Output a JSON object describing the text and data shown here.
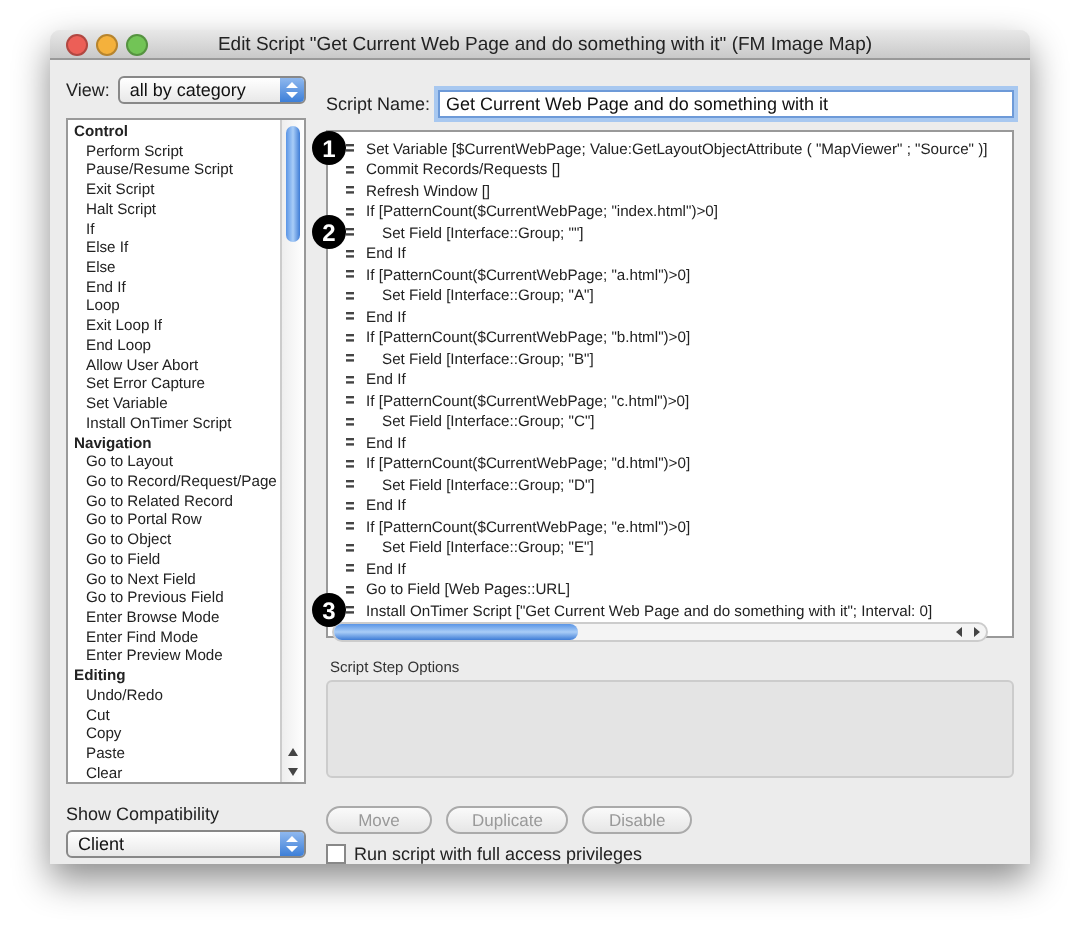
{
  "window": {
    "title": "Edit Script \"Get Current Web Page and do something with it\" (FM Image Map)"
  },
  "view": {
    "label": "View:",
    "value": "all by category"
  },
  "steps": [
    {
      "kind": "header",
      "label": "Control"
    },
    {
      "kind": "item",
      "label": "Perform Script"
    },
    {
      "kind": "item",
      "label": "Pause/Resume Script"
    },
    {
      "kind": "item",
      "label": "Exit Script"
    },
    {
      "kind": "item",
      "label": "Halt Script"
    },
    {
      "kind": "item",
      "label": "If"
    },
    {
      "kind": "item",
      "label": "Else If"
    },
    {
      "kind": "item",
      "label": "Else"
    },
    {
      "kind": "item",
      "label": "End If"
    },
    {
      "kind": "item",
      "label": "Loop"
    },
    {
      "kind": "item",
      "label": "Exit Loop If"
    },
    {
      "kind": "item",
      "label": "End Loop"
    },
    {
      "kind": "item",
      "label": "Allow User Abort"
    },
    {
      "kind": "item",
      "label": "Set Error Capture"
    },
    {
      "kind": "item",
      "label": "Set Variable"
    },
    {
      "kind": "item",
      "label": "Install OnTimer Script"
    },
    {
      "kind": "header",
      "label": "Navigation"
    },
    {
      "kind": "item",
      "label": "Go to Layout"
    },
    {
      "kind": "item",
      "label": "Go to Record/Request/Page"
    },
    {
      "kind": "item",
      "label": "Go to Related Record"
    },
    {
      "kind": "item",
      "label": "Go to Portal Row"
    },
    {
      "kind": "item",
      "label": "Go to Object"
    },
    {
      "kind": "item",
      "label": "Go to Field"
    },
    {
      "kind": "item",
      "label": "Go to Next Field"
    },
    {
      "kind": "item",
      "label": "Go to Previous Field"
    },
    {
      "kind": "item",
      "label": "Enter Browse Mode"
    },
    {
      "kind": "item",
      "label": "Enter Find Mode"
    },
    {
      "kind": "item",
      "label": "Enter Preview Mode"
    },
    {
      "kind": "header",
      "label": "Editing"
    },
    {
      "kind": "item",
      "label": "Undo/Redo"
    },
    {
      "kind": "item",
      "label": "Cut"
    },
    {
      "kind": "item",
      "label": "Copy"
    },
    {
      "kind": "item",
      "label": "Paste"
    },
    {
      "kind": "item",
      "label": "Clear"
    }
  ],
  "compatibility": {
    "label": "Show Compatibility",
    "value": "Client"
  },
  "script_name": {
    "label": "Script Name:",
    "value": "Get Current Web Page and do something with it"
  },
  "script": [
    {
      "text": "Set Variable [$CurrentWebPage; Value:GetLayoutObjectAttribute ( \"MapViewer\" ; \"Source\" )]",
      "indented": false,
      "callout": "1"
    },
    {
      "text": "Commit Records/Requests []",
      "indented": false
    },
    {
      "text": "Refresh Window []",
      "indented": false
    },
    {
      "text": "If [PatternCount($CurrentWebPage; \"index.html\")>0]",
      "indented": false
    },
    {
      "text": "Set Field [Interface::Group; \"\"]",
      "indented": true,
      "callout": "2"
    },
    {
      "text": "End If",
      "indented": false
    },
    {
      "text": "If [PatternCount($CurrentWebPage; \"a.html\")>0]",
      "indented": false
    },
    {
      "text": "Set Field [Interface::Group; \"A\"]",
      "indented": true
    },
    {
      "text": "End If",
      "indented": false
    },
    {
      "text": "If [PatternCount($CurrentWebPage; \"b.html\")>0]",
      "indented": false
    },
    {
      "text": "Set Field [Interface::Group; \"B\"]",
      "indented": true
    },
    {
      "text": "End If",
      "indented": false
    },
    {
      "text": "If [PatternCount($CurrentWebPage; \"c.html\")>0]",
      "indented": false
    },
    {
      "text": "Set Field [Interface::Group; \"C\"]",
      "indented": true
    },
    {
      "text": "End If",
      "indented": false
    },
    {
      "text": "If [PatternCount($CurrentWebPage; \"d.html\")>0]",
      "indented": false
    },
    {
      "text": "Set Field [Interface::Group; \"D\"]",
      "indented": true
    },
    {
      "text": "End If",
      "indented": false
    },
    {
      "text": "If [PatternCount($CurrentWebPage; \"e.html\")>0]",
      "indented": false
    },
    {
      "text": "Set Field [Interface::Group; \"E\"]",
      "indented": true
    },
    {
      "text": "End If",
      "indented": false
    },
    {
      "text": "Go to Field [Web Pages::URL]",
      "indented": false
    },
    {
      "text": "Install OnTimer Script [\"Get Current Web Page and do something with it\"; Interval: 0]",
      "indented": false,
      "callout": "3"
    }
  ],
  "options": {
    "title": "Script Step Options"
  },
  "buttons": [
    {
      "label": "Move",
      "disabled": true
    },
    {
      "label": "Duplicate",
      "disabled": true
    },
    {
      "label": "Disable",
      "disabled": true
    }
  ],
  "full_access": {
    "label": "Run script with full access privileges",
    "checked": false
  }
}
